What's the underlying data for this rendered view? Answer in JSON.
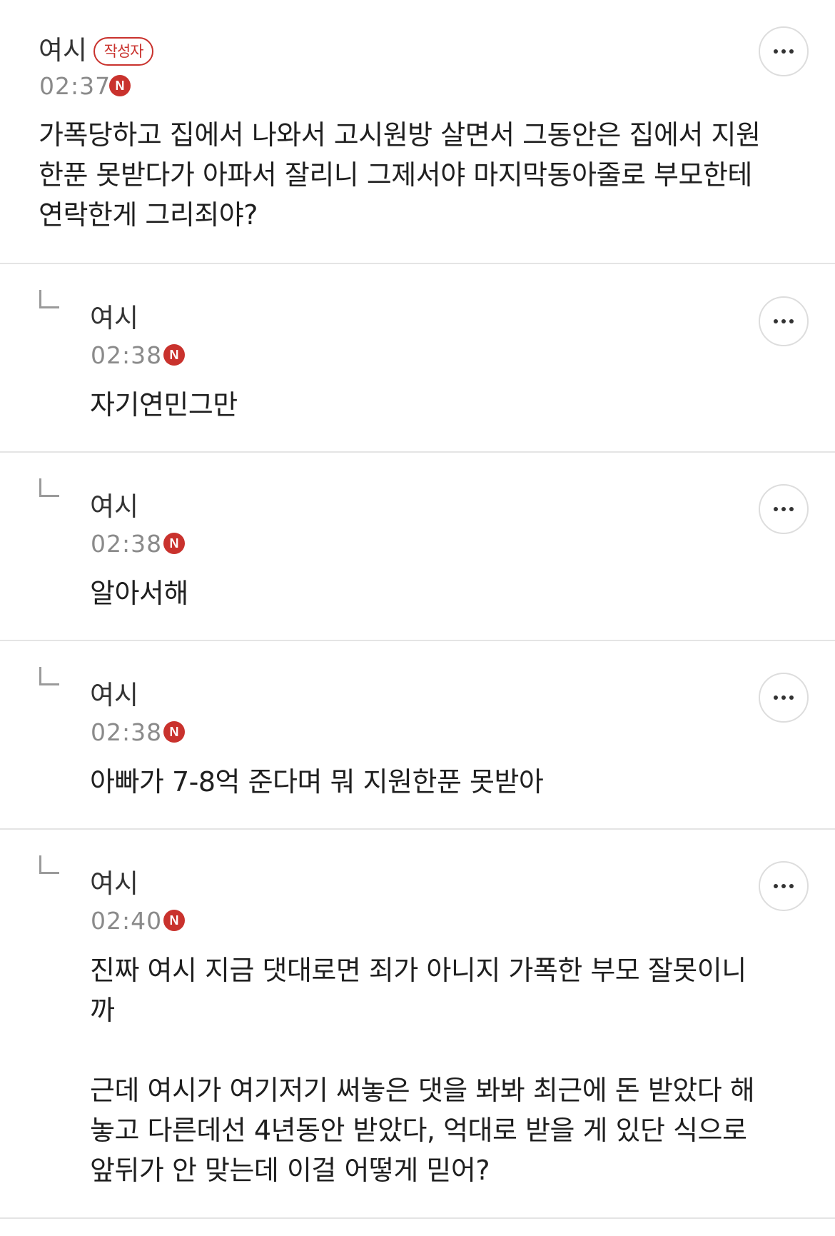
{
  "comments": [
    {
      "author": "여시",
      "badge": "작성자",
      "time": "02:37",
      "new_badge": "N",
      "text": "가폭당하고 집에서 나와서 고시원방 살면서 그동안은 집에서 지원\n한푼 못받다가 아파서 잘리니 그제서야 마지막동아줄로 부모한테\n연락한게 그리죄야?"
    },
    {
      "author": "여시",
      "time": "02:38",
      "new_badge": "N",
      "text": "자기연민그만"
    },
    {
      "author": "여시",
      "time": "02:38",
      "new_badge": "N",
      "text": "알아서해"
    },
    {
      "author": "여시",
      "time": "02:38",
      "new_badge": "N",
      "text": "아빠가 7-8억 준다며 뭐 지원한푼 못받아"
    },
    {
      "author": "여시",
      "time": "02:40",
      "new_badge": "N",
      "text": "진짜 여시 지금 댓대로면 죄가 아니지 가폭한 부모 잘못이니\n까\n\n근데 여시가 여기저기 써놓은 댓을 봐봐 최근에 돈 받았다 해\n놓고 다른데선 4년동안 받았다, 억대로 받을 게 있단 식으로\n앞뒤가 안 맞는데 이걸 어떻게 믿어?"
    }
  ],
  "icons": {
    "more": "more-horizontal-icon",
    "reply": "reply-arrow-icon",
    "new": "new-badge-icon"
  },
  "colors": {
    "accent": "#c9322d",
    "divider": "#e4e4e4",
    "meta_text": "#8a8a8a"
  }
}
